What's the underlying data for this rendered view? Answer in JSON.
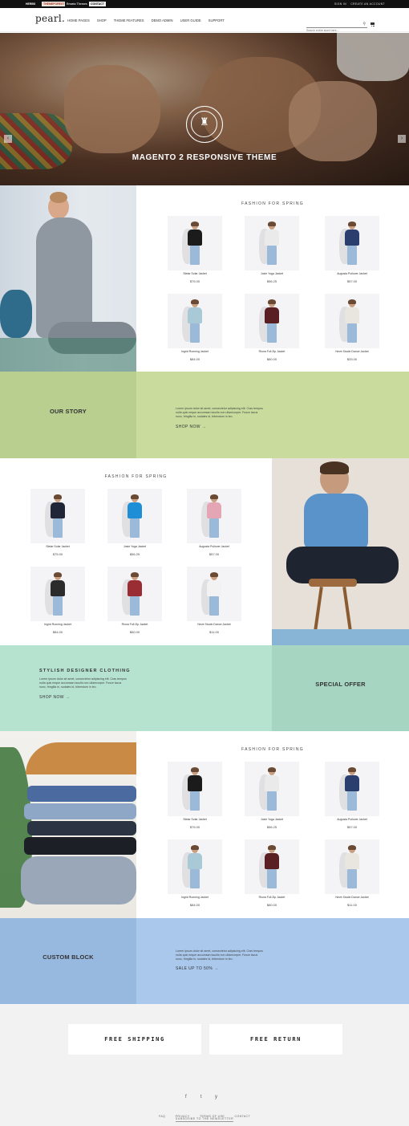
{
  "topbar": {
    "promos": [
      "HERBS",
      "THEMEFOREST",
      "Envato Themes",
      "CONTACT"
    ],
    "account": [
      "SIGN IN",
      "CREATE AN ACCOUNT"
    ]
  },
  "header": {
    "logo": "pearl.",
    "nav": [
      "HOME PAGES",
      "SHOP",
      "THEME FEATURES",
      "DEMO ADMIN",
      "USER GUIDE",
      "SUPPORT"
    ],
    "search_placeholder": "Search entire store here..."
  },
  "hero": {
    "title": "MAGENTO 2 RESPONSIVE THEME",
    "prev": "‹",
    "next": "›"
  },
  "section1": {
    "title": "FASHION FOR SPRING",
    "products": [
      {
        "name": "Stelar Solar Jacket",
        "price": "$75.00",
        "top": "#1b1b1b"
      },
      {
        "name": "Josie Yoga Jacket",
        "price": "$56.25",
        "top": "#eaeaea"
      },
      {
        "name": "Augusta Pullover Jacket",
        "price": "$57.00",
        "top": "#2b3f6e"
      },
      {
        "name": "Ingrid Running Jacket",
        "price": "$84.00",
        "top": "#a9c9d6"
      },
      {
        "name": "Riona Full Zip Jacket",
        "price": "$60.00",
        "top": "#5a1f22"
      },
      {
        "name": "Neve Studio Dance Jacket",
        "price": "$33.00",
        "top": "#e9e6e0"
      }
    ]
  },
  "story": {
    "title": "OUR STORY",
    "text": "Lorem ipsum dolor sit amet, consectetur adipiscing elit. Cras tempus nulla quis neque accumsan iaculis non ullamcorper. Fusce lacus nunc, fringilla in, sodales id, bibendum in leo.",
    "link": "SHOP NOW →",
    "color_left": "#b8cf8f",
    "color_right": "#c9dc9e"
  },
  "section2": {
    "title": "FASHION FOR SPRING",
    "products": [
      {
        "name": "Stelar Solar Jacket",
        "price": "$75.00",
        "top": "#202538"
      },
      {
        "name": "Josie Yoga Jacket",
        "price": "$56.25",
        "top": "#1e8fd6"
      },
      {
        "name": "Augusta Pullover Jacket",
        "price": "$57.00",
        "top": "#e4a6b4"
      },
      {
        "name": "Ingrid Running Jacket",
        "price": "$84.00",
        "top": "#2b2b2b"
      },
      {
        "name": "Riona Full Zip Jacket",
        "price": "$60.00",
        "top": "#9a2d33"
      },
      {
        "name": "Neve Studio Dance Jacket",
        "price": "$11.00",
        "top": "#f2f2f2"
      }
    ]
  },
  "designer": {
    "heading": "STYLISH DESIGNER CLOTHING",
    "text": "Lorem ipsum dolor sit amet, consectetur adipiscing elit. Cras tempus nulla quis neque accumsan iaculis non ullamcorper. Fusce lacus nunc, fringilla in, sodales id, bibendum in leo.",
    "link": "SHOP NOW →",
    "special": "SPECIAL OFFER",
    "color_left": "#b6e2d0",
    "color_right": "#a6d6c2"
  },
  "section3": {
    "title": "FASHION FOR SPRING",
    "products": [
      {
        "name": "Stelar Solar Jacket",
        "price": "$75.00",
        "top": "#1b1b1b"
      },
      {
        "name": "Josie Yoga Jacket",
        "price": "$56.25",
        "top": "#eaeaea"
      },
      {
        "name": "Augusta Pullover Jacket",
        "price": "$57.00",
        "top": "#2b3f6e"
      },
      {
        "name": "Ingrid Running Jacket",
        "price": "$84.00",
        "top": "#a9c9d6"
      },
      {
        "name": "Riona Full Zip Jacket",
        "price": "$60.00",
        "top": "#5a1f22"
      },
      {
        "name": "Neve Studio Dance Jacket",
        "price": "$11.00",
        "top": "#e9e6e0"
      }
    ]
  },
  "custom": {
    "title": "CUSTOM BLOCK",
    "text": "Lorem ipsum dolor sit amet, consectetur adipiscing elit. Cras tempus nulla quis neque accumsan iaculis non ullamcorper. Fusce lacus nunc, fringilla in, sodales id, bibendum in leo.",
    "link": "SALE UP TO 50% →",
    "color_left": "#97b9e0",
    "color_right": "#a9c8ec"
  },
  "services": {
    "shipping": "FREE SHIPPING",
    "returns": "FREE RETURN"
  },
  "footer": {
    "social": [
      "f",
      "t",
      "y"
    ],
    "links": [
      "FAQ",
      "PRIVACY",
      "TERMS OF USE",
      "CONTACT"
    ],
    "newsletter": "SUBSCRIBE TO THE NEWSLETTER"
  }
}
